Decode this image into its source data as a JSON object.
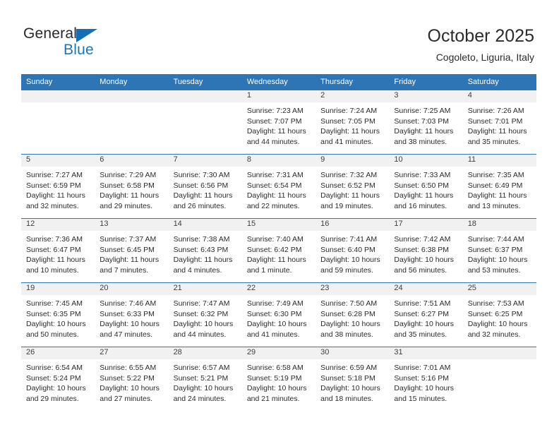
{
  "brand": {
    "name_part1": "General",
    "name_part2": "Blue",
    "triangle_color": "#146fb5",
    "blue_color": "#1b75bb"
  },
  "header": {
    "title": "October 2025",
    "subtitle": "Cogoleto, Liguria, Italy"
  },
  "theme": {
    "header_blue": "#2e75b6",
    "daynum_band": "#f1f1f1",
    "text": "#2b2b2b"
  },
  "weekday_headers": [
    "Sunday",
    "Monday",
    "Tuesday",
    "Wednesday",
    "Thursday",
    "Friday",
    "Saturday"
  ],
  "weeks": [
    [
      {
        "day": "",
        "lines": []
      },
      {
        "day": "",
        "lines": []
      },
      {
        "day": "",
        "lines": []
      },
      {
        "day": "1",
        "lines": [
          "Sunrise: 7:23 AM",
          "Sunset: 7:07 PM",
          "Daylight: 11 hours",
          "and 44 minutes."
        ]
      },
      {
        "day": "2",
        "lines": [
          "Sunrise: 7:24 AM",
          "Sunset: 7:05 PM",
          "Daylight: 11 hours",
          "and 41 minutes."
        ]
      },
      {
        "day": "3",
        "lines": [
          "Sunrise: 7:25 AM",
          "Sunset: 7:03 PM",
          "Daylight: 11 hours",
          "and 38 minutes."
        ]
      },
      {
        "day": "4",
        "lines": [
          "Sunrise: 7:26 AM",
          "Sunset: 7:01 PM",
          "Daylight: 11 hours",
          "and 35 minutes."
        ]
      }
    ],
    [
      {
        "day": "5",
        "lines": [
          "Sunrise: 7:27 AM",
          "Sunset: 6:59 PM",
          "Daylight: 11 hours",
          "and 32 minutes."
        ]
      },
      {
        "day": "6",
        "lines": [
          "Sunrise: 7:29 AM",
          "Sunset: 6:58 PM",
          "Daylight: 11 hours",
          "and 29 minutes."
        ]
      },
      {
        "day": "7",
        "lines": [
          "Sunrise: 7:30 AM",
          "Sunset: 6:56 PM",
          "Daylight: 11 hours",
          "and 26 minutes."
        ]
      },
      {
        "day": "8",
        "lines": [
          "Sunrise: 7:31 AM",
          "Sunset: 6:54 PM",
          "Daylight: 11 hours",
          "and 22 minutes."
        ]
      },
      {
        "day": "9",
        "lines": [
          "Sunrise: 7:32 AM",
          "Sunset: 6:52 PM",
          "Daylight: 11 hours",
          "and 19 minutes."
        ]
      },
      {
        "day": "10",
        "lines": [
          "Sunrise: 7:33 AM",
          "Sunset: 6:50 PM",
          "Daylight: 11 hours",
          "and 16 minutes."
        ]
      },
      {
        "day": "11",
        "lines": [
          "Sunrise: 7:35 AM",
          "Sunset: 6:49 PM",
          "Daylight: 11 hours",
          "and 13 minutes."
        ]
      }
    ],
    [
      {
        "day": "12",
        "lines": [
          "Sunrise: 7:36 AM",
          "Sunset: 6:47 PM",
          "Daylight: 11 hours",
          "and 10 minutes."
        ]
      },
      {
        "day": "13",
        "lines": [
          "Sunrise: 7:37 AM",
          "Sunset: 6:45 PM",
          "Daylight: 11 hours",
          "and 7 minutes."
        ]
      },
      {
        "day": "14",
        "lines": [
          "Sunrise: 7:38 AM",
          "Sunset: 6:43 PM",
          "Daylight: 11 hours",
          "and 4 minutes."
        ]
      },
      {
        "day": "15",
        "lines": [
          "Sunrise: 7:40 AM",
          "Sunset: 6:42 PM",
          "Daylight: 11 hours",
          "and 1 minute."
        ]
      },
      {
        "day": "16",
        "lines": [
          "Sunrise: 7:41 AM",
          "Sunset: 6:40 PM",
          "Daylight: 10 hours",
          "and 59 minutes."
        ]
      },
      {
        "day": "17",
        "lines": [
          "Sunrise: 7:42 AM",
          "Sunset: 6:38 PM",
          "Daylight: 10 hours",
          "and 56 minutes."
        ]
      },
      {
        "day": "18",
        "lines": [
          "Sunrise: 7:44 AM",
          "Sunset: 6:37 PM",
          "Daylight: 10 hours",
          "and 53 minutes."
        ]
      }
    ],
    [
      {
        "day": "19",
        "lines": [
          "Sunrise: 7:45 AM",
          "Sunset: 6:35 PM",
          "Daylight: 10 hours",
          "and 50 minutes."
        ]
      },
      {
        "day": "20",
        "lines": [
          "Sunrise: 7:46 AM",
          "Sunset: 6:33 PM",
          "Daylight: 10 hours",
          "and 47 minutes."
        ]
      },
      {
        "day": "21",
        "lines": [
          "Sunrise: 7:47 AM",
          "Sunset: 6:32 PM",
          "Daylight: 10 hours",
          "and 44 minutes."
        ]
      },
      {
        "day": "22",
        "lines": [
          "Sunrise: 7:49 AM",
          "Sunset: 6:30 PM",
          "Daylight: 10 hours",
          "and 41 minutes."
        ]
      },
      {
        "day": "23",
        "lines": [
          "Sunrise: 7:50 AM",
          "Sunset: 6:28 PM",
          "Daylight: 10 hours",
          "and 38 minutes."
        ]
      },
      {
        "day": "24",
        "lines": [
          "Sunrise: 7:51 AM",
          "Sunset: 6:27 PM",
          "Daylight: 10 hours",
          "and 35 minutes."
        ]
      },
      {
        "day": "25",
        "lines": [
          "Sunrise: 7:53 AM",
          "Sunset: 6:25 PM",
          "Daylight: 10 hours",
          "and 32 minutes."
        ]
      }
    ],
    [
      {
        "day": "26",
        "lines": [
          "Sunrise: 6:54 AM",
          "Sunset: 5:24 PM",
          "Daylight: 10 hours",
          "and 29 minutes."
        ]
      },
      {
        "day": "27",
        "lines": [
          "Sunrise: 6:55 AM",
          "Sunset: 5:22 PM",
          "Daylight: 10 hours",
          "and 27 minutes."
        ]
      },
      {
        "day": "28",
        "lines": [
          "Sunrise: 6:57 AM",
          "Sunset: 5:21 PM",
          "Daylight: 10 hours",
          "and 24 minutes."
        ]
      },
      {
        "day": "29",
        "lines": [
          "Sunrise: 6:58 AM",
          "Sunset: 5:19 PM",
          "Daylight: 10 hours",
          "and 21 minutes."
        ]
      },
      {
        "day": "30",
        "lines": [
          "Sunrise: 6:59 AM",
          "Sunset: 5:18 PM",
          "Daylight: 10 hours",
          "and 18 minutes."
        ]
      },
      {
        "day": "31",
        "lines": [
          "Sunrise: 7:01 AM",
          "Sunset: 5:16 PM",
          "Daylight: 10 hours",
          "and 15 minutes."
        ]
      },
      {
        "day": "",
        "lines": []
      }
    ]
  ]
}
